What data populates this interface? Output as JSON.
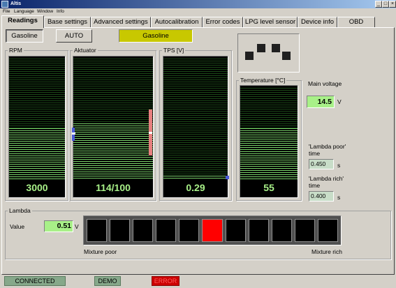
{
  "window": {
    "title": "Altis",
    "minimize": "_",
    "maximize": "□",
    "close": "×"
  },
  "menu": [
    "File",
    "Language",
    "Window",
    "Info"
  ],
  "tabs": [
    "Readings",
    "Base settings",
    "Advanced settings",
    "Autocalibration",
    "Error codes",
    "LPG level sensor",
    "Device info",
    "OBD"
  ],
  "controls": {
    "fuel_button": "Gasoline",
    "mode_button": "AUTO",
    "fuel_indicator": "Gasoline"
  },
  "injector_pattern": {
    "active": [
      false,
      true,
      false,
      true
    ],
    "description": "4 injector indicators"
  },
  "gauges": {
    "rpm": {
      "title": "RPM",
      "value": "3000",
      "level": 0.42,
      "color": "#7ad36a"
    },
    "actuator": {
      "title": "Aktuator",
      "value": "114/100",
      "level": 0.46,
      "color": "#7ad36a"
    },
    "tps": {
      "title": "TPS [V]",
      "value": "0.29",
      "level": 0.03,
      "color": "#7ad36a"
    },
    "temperature": {
      "title": "Temperature  [°C]",
      "value": "55",
      "level": 0.56,
      "color": "#7ad36a"
    }
  },
  "main_voltage": {
    "label": "Main voltage",
    "value": "14.5",
    "unit": "V"
  },
  "lambda_poor": {
    "label": "'Lambda poor' time",
    "value": "0.450",
    "unit": "s"
  },
  "lambda_rich": {
    "label": "'Lambda rich' time",
    "value": "0.400",
    "unit": "s"
  },
  "lambda": {
    "title": "Lambda",
    "value_label": "Value",
    "value": "0.51",
    "unit": "V",
    "poor_label": "Mixture poor",
    "rich_label": "Mixture rich",
    "active_index": 5,
    "segment_count": 11,
    "active_color": "#ff0000"
  },
  "status": {
    "connected": "CONNECTED",
    "demo": "DEMO",
    "error": "ERROR"
  },
  "colors": {
    "connected_bg": "#86a88a",
    "demo_bg": "#86a88a",
    "error_bg": "#cc0000",
    "error_text": "#ff6060",
    "lime_indicator": "#c8c800",
    "field_green": "#a8f088"
  }
}
